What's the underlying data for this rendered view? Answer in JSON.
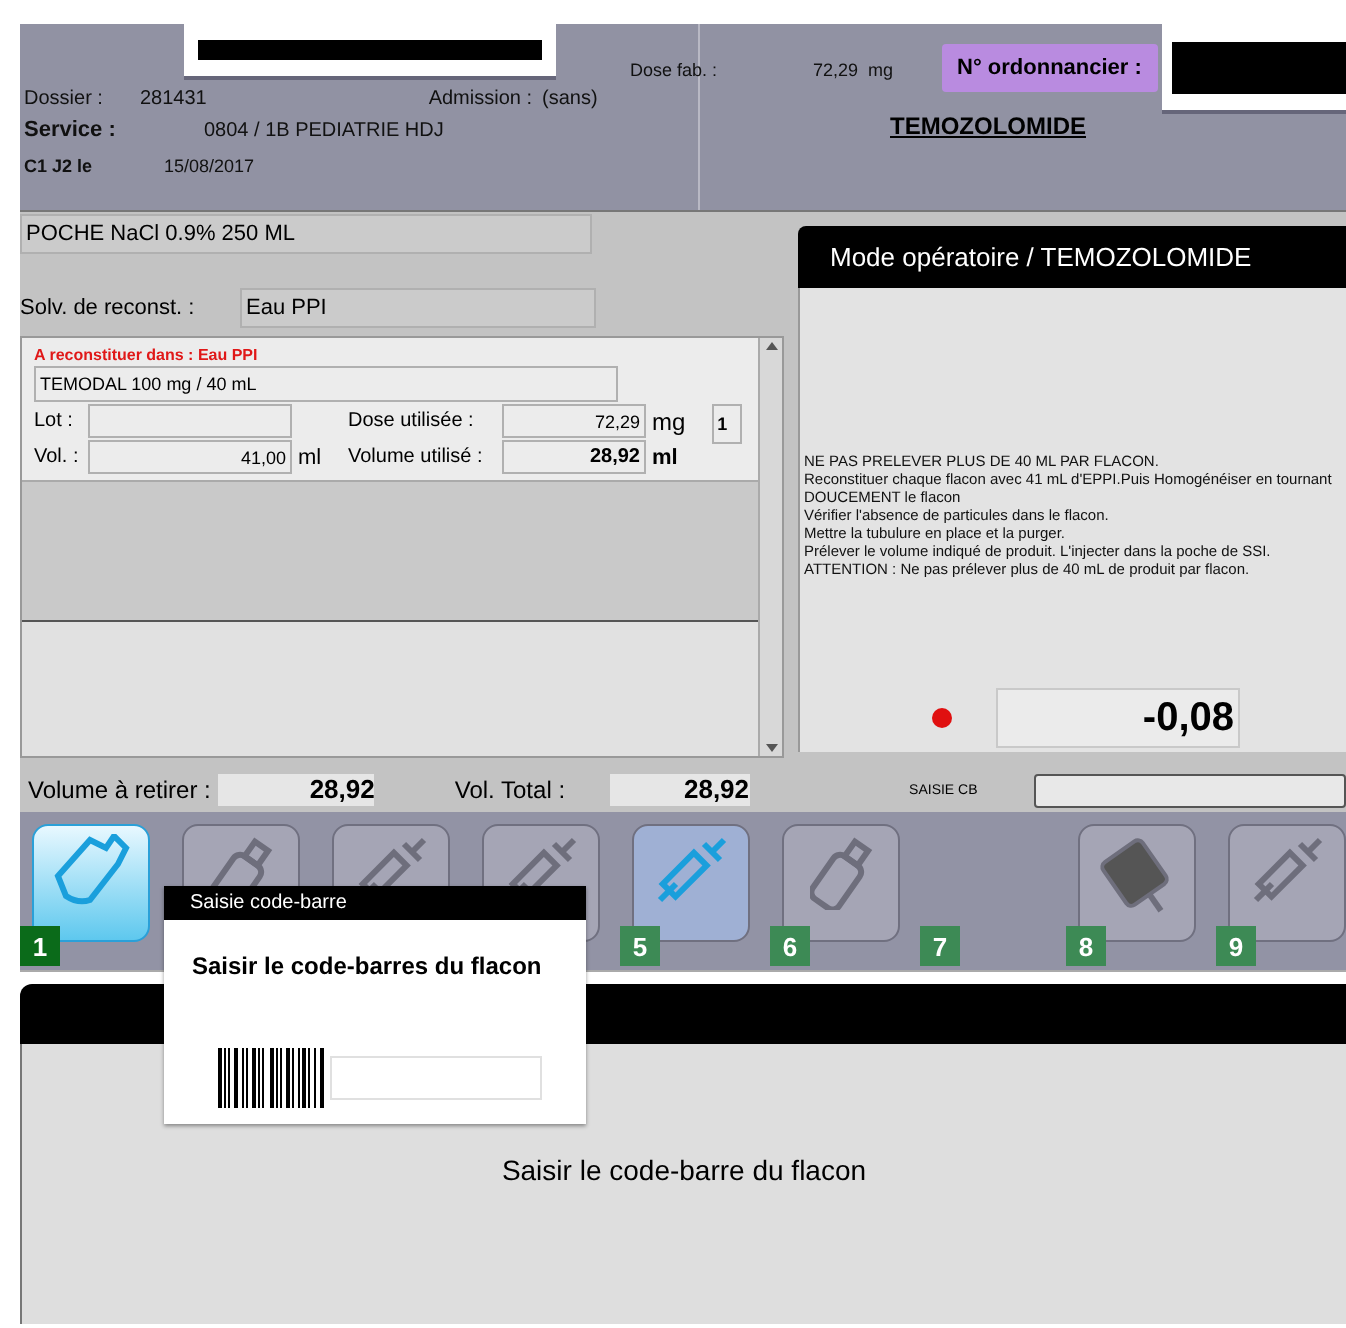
{
  "header": {
    "dossier_label": "Dossier :",
    "dossier": "281431",
    "admission_label": "Admission :",
    "admission": "(sans)",
    "service_label": "Service :",
    "service": "0804 / 1B PEDIATRIE HDJ",
    "cycle_label": "C1 J2 le",
    "date": "15/08/2017",
    "dose_label": "Dose fab. :",
    "dose": "72,29",
    "dose_unit": "mg",
    "ordonnancier_label": "N° ordonnancier :",
    "drug": "TEMOZOLOMIDE"
  },
  "poche": "POCHE NaCl 0.9% 250 ML",
  "solvent": {
    "label": "Solv. de reconst. :",
    "value": "Eau PPI"
  },
  "vial": {
    "warning": "A reconstituer dans : Eau PPI",
    "name": "TEMODAL 100 mg / 40 mL",
    "lot_label": "Lot :",
    "vol_label": "Vol. :",
    "vol": "41,00",
    "vol_unit": "ml",
    "dose_label": "Dose utilisée :",
    "dose": "72,29",
    "dose_unit": "mg",
    "volume_label": "Volume utilisé :",
    "volume": "28,92",
    "volume_unit": "ml",
    "count": "1"
  },
  "procedure": {
    "title": "Mode opératoire / TEMOZOLOMIDE",
    "lines": [
      "NE PAS PRELEVER PLUS DE 40 ML PAR FLACON.",
      "Reconstituer chaque flacon avec 41 mL d'EPPI.Puis Homogénéiser en tournant DOUCEMENT le flacon",
      "Vérifier l'absence de particules dans le flacon.",
      "Mettre la tubulure en place et la purger.",
      "Prélever le volume indiqué de produit. L'injecter dans la poche de SSI.",
      "ATTENTION : Ne pas prélever plus de 40 mL de produit par flacon."
    ],
    "reading": "-0,08"
  },
  "totals": {
    "retirer_label": "Volume à retirer :",
    "retirer": "28,92",
    "total_label": "Vol. Total :",
    "total": "28,92",
    "cb_label": "SAISIE CB"
  },
  "steps": [
    {
      "number": "1",
      "kind": "scanner",
      "selected": true,
      "highlighted": false
    },
    {
      "kind": "bottle",
      "selected": false,
      "highlighted": false
    },
    {
      "kind": "syringe",
      "selected": false,
      "highlighted": false
    },
    {
      "kind": "syringe",
      "selected": false,
      "highlighted": false
    },
    {
      "number": "5",
      "kind": "syringe",
      "selected": false,
      "highlighted": true
    },
    {
      "number": "6",
      "kind": "bottle",
      "selected": false,
      "highlighted": false
    },
    {
      "number": "7",
      "kind": "none"
    },
    {
      "number": "8",
      "kind": "bag",
      "selected": false,
      "highlighted": false
    },
    {
      "number": "9",
      "kind": "syringe",
      "selected": false,
      "highlighted": false
    }
  ],
  "popup": {
    "title": "Saisie code-barre",
    "prompt": "Saisir le code-barres du flacon"
  },
  "bottom": {
    "message": "Saisir le code-barre du flacon"
  }
}
